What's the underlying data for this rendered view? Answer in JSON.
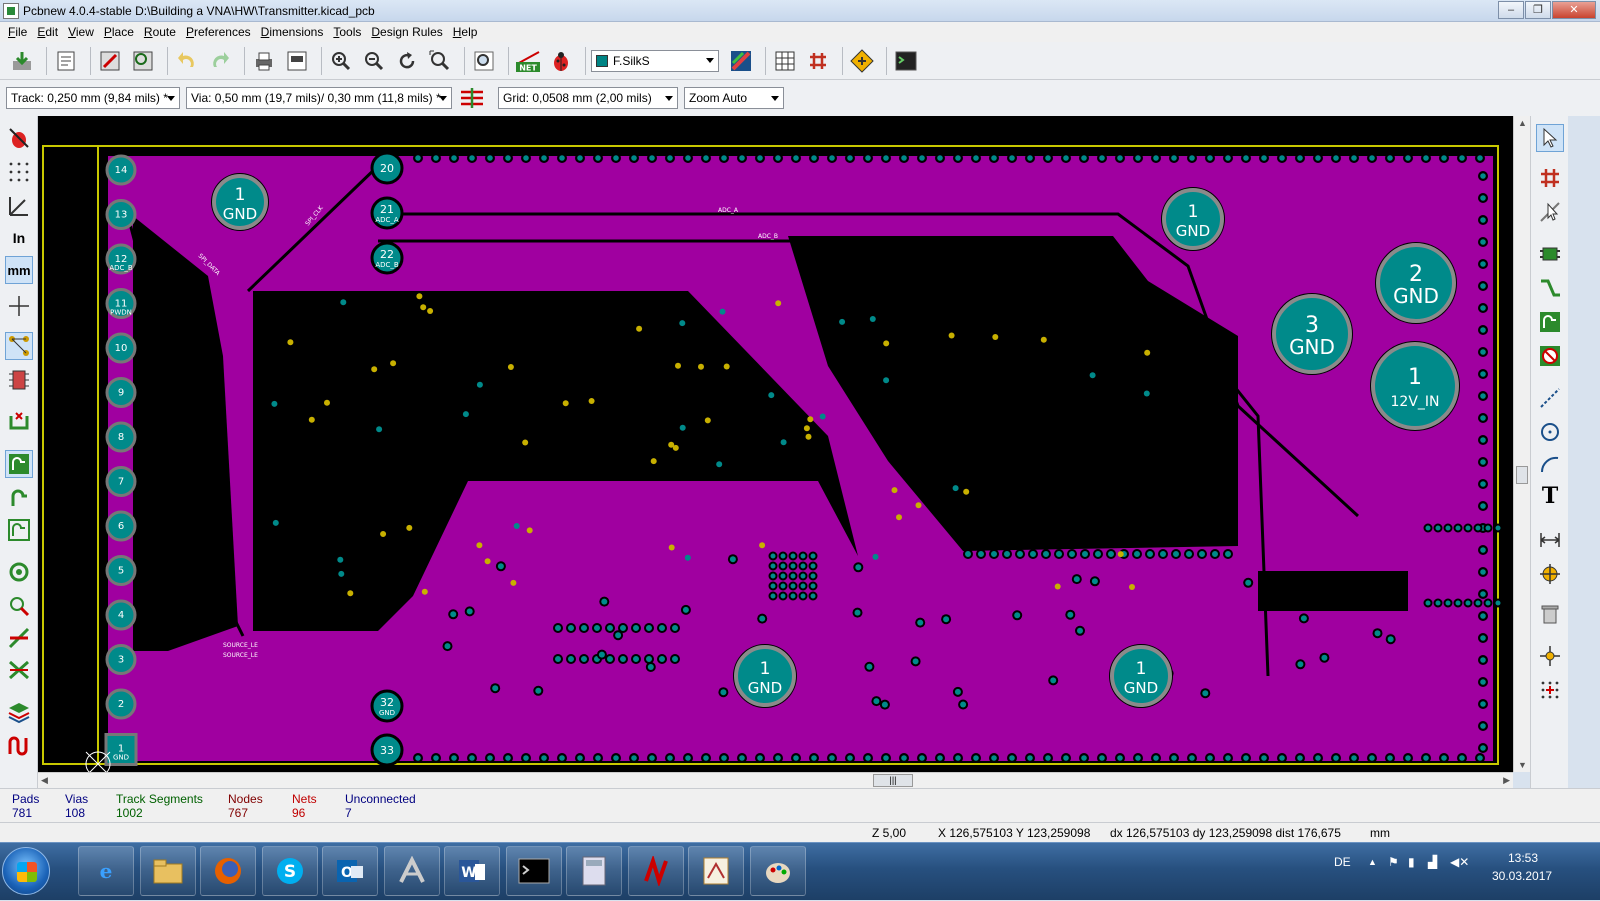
{
  "window": {
    "title": "Pcbnew 4.0.4-stable D:\\Building a VNA\\HW\\Transmitter.kicad_pcb",
    "minimize_glyph": "–",
    "restore_glyph": "❐",
    "close_glyph": "✕"
  },
  "menu": [
    "File",
    "Edit",
    "View",
    "Place",
    "Route",
    "Preferences",
    "Dimensions",
    "Tools",
    "Design Rules",
    "Help"
  ],
  "toolbar": {
    "active_layer": "F.SilkS",
    "net_label": "NET"
  },
  "aux_toolbar": {
    "track": "Track: 0,250 mm (9,84 mils) *",
    "via": "Via: 0,50 mm (19,7 mils)/ 0,30 mm (11,8 mils) *",
    "grid": "Grid: 0,0508 mm (2,00 mils)",
    "zoom": "Zoom Auto"
  },
  "left_toolbar": {
    "units_in": "In",
    "units_mm": "mm"
  },
  "pcb": {
    "colors": {
      "copper_fill": "#a000a0",
      "pad": "#008a8a",
      "via": "#c8b000",
      "background": "#000000",
      "outline": "#c8c800"
    },
    "connector_pads": [
      "14",
      "13",
      "12",
      "11",
      "10",
      "9",
      "8",
      "7",
      "6",
      "5",
      "4",
      "3",
      "2",
      "1"
    ],
    "connector_pad_nets": [
      "",
      "",
      "ADC_B",
      "PWDN",
      "",
      "",
      "",
      "",
      "",
      "",
      "",
      "",
      "",
      "GND"
    ],
    "header_pads": [
      {
        "num": "20",
        "net": ""
      },
      {
        "num": "21",
        "net": "ADC_A"
      },
      {
        "num": "22",
        "net": "ADC_B"
      },
      {
        "num": "32",
        "net": "GND"
      },
      {
        "num": "33",
        "net": ""
      }
    ],
    "large_pads": [
      {
        "num": "1",
        "net": "GND"
      },
      {
        "num": "1",
        "net": "GND"
      },
      {
        "num": "2",
        "net": "GND"
      },
      {
        "num": "3",
        "net": "GND"
      },
      {
        "num": "1",
        "net": "12V_IN"
      },
      {
        "num": "1",
        "net": "GND"
      },
      {
        "num": "1",
        "net": "GND"
      }
    ],
    "track_labels": [
      "ADC_A",
      "ADC_B",
      "SPI_DATA",
      "SPI_CLK",
      "SOURCE_LE",
      "SOURCE_LE"
    ]
  },
  "message_panel": [
    {
      "label": "Pads",
      "value": "781",
      "color": "#000080"
    },
    {
      "label": "Vias",
      "value": "108",
      "color": "#000080"
    },
    {
      "label": "Track Segments",
      "value": "1002",
      "color": "#006000"
    },
    {
      "label": "Nodes",
      "value": "767",
      "color": "#800000"
    },
    {
      "label": "Nets",
      "value": "96",
      "color": "#c00000"
    },
    {
      "label": "Unconnected",
      "value": "7",
      "color": "#000080"
    }
  ],
  "status": {
    "zoom": "Z 5,00",
    "abs": "X 126,575103  Y 123,259098",
    "rel": "dx 126,575103  dy 123,259098  dist 176,675",
    "units": "mm"
  },
  "taskbar": {
    "lang": "DE",
    "time": "13:53",
    "date": "30.03.2017"
  }
}
